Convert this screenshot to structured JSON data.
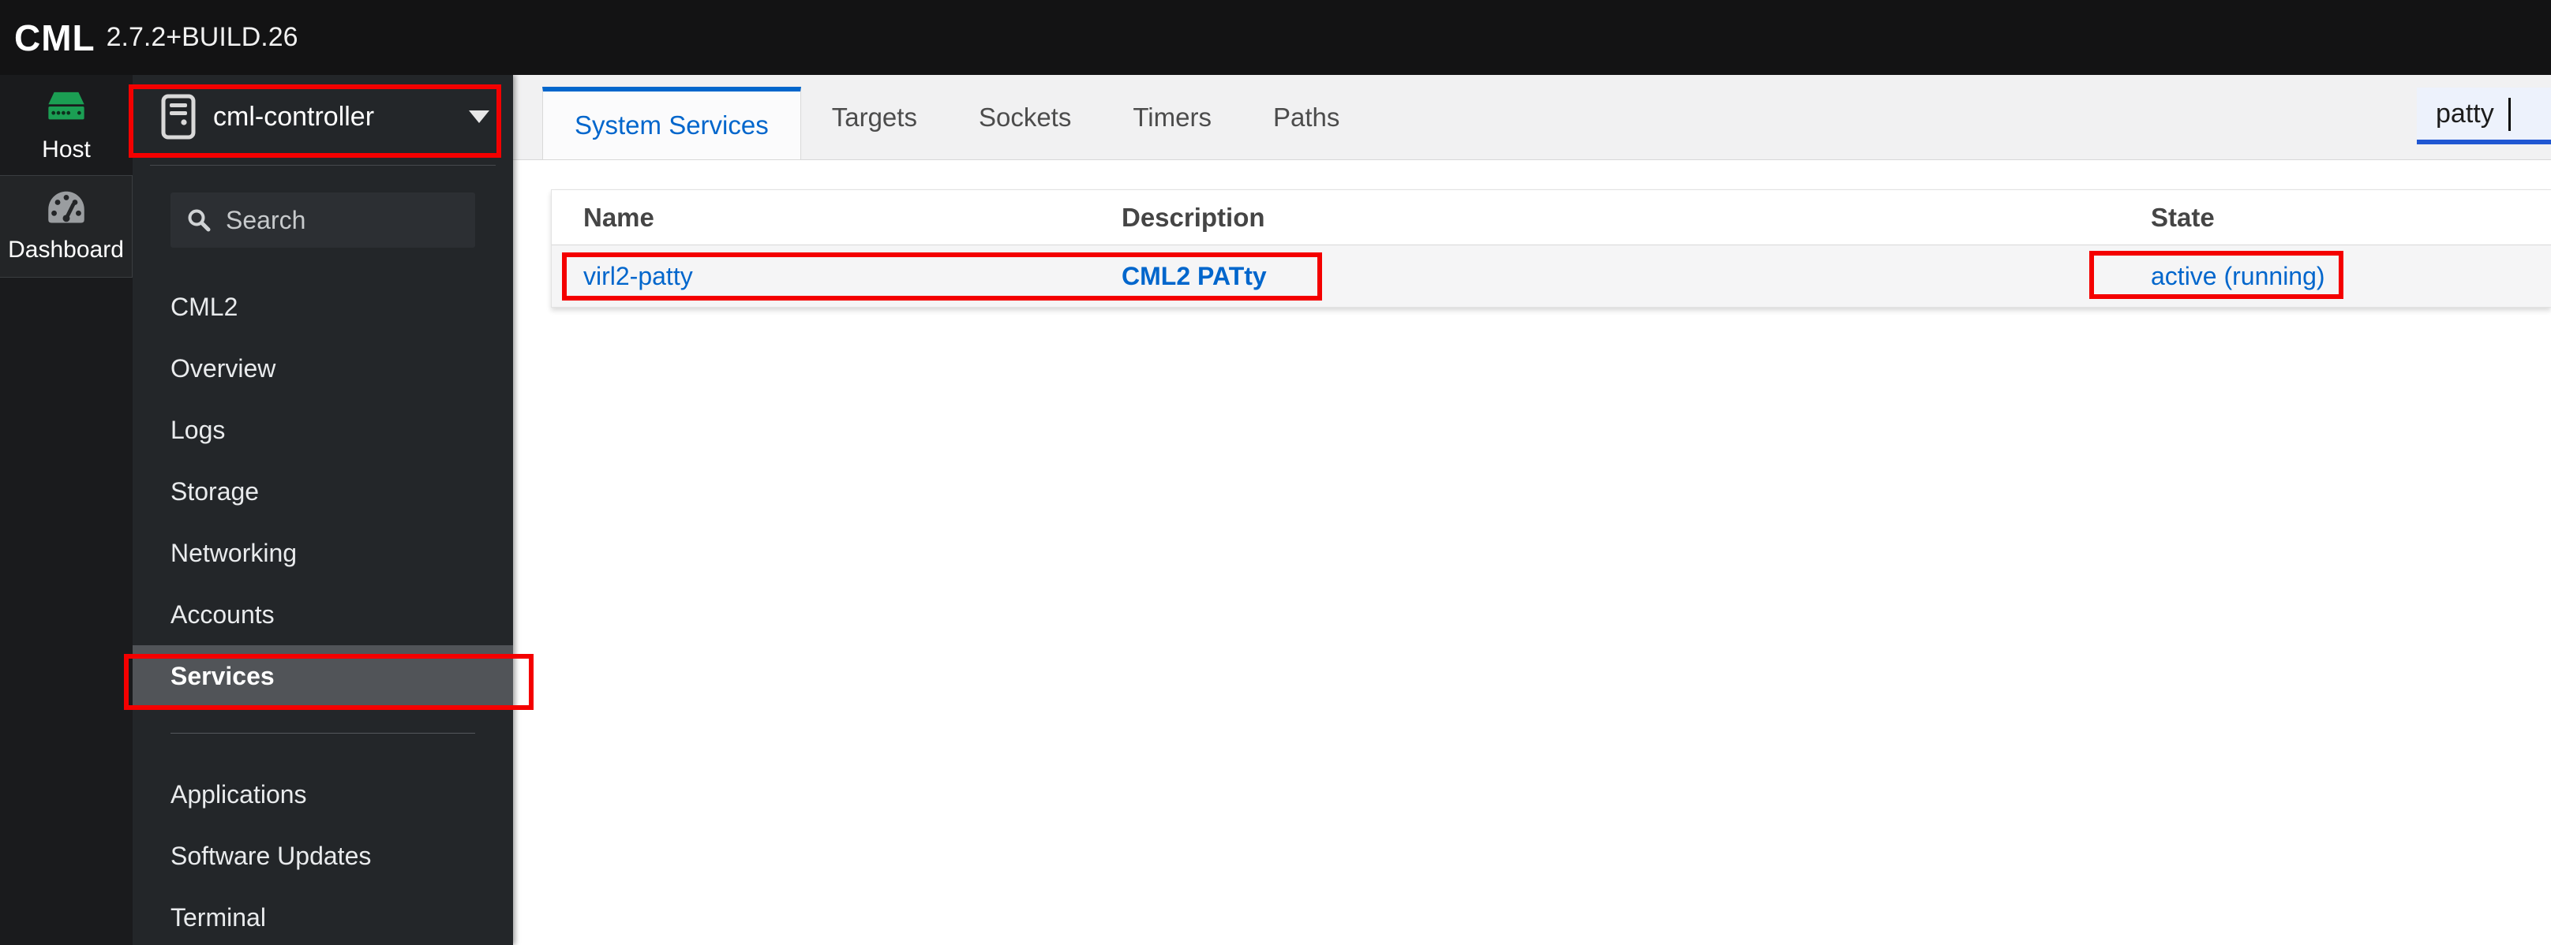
{
  "header": {
    "brand": "CML",
    "version": "2.7.2+BUILD.26"
  },
  "app_nav": {
    "items": [
      {
        "label": "Host",
        "icon": "server-icon"
      },
      {
        "label": "Dashboard",
        "icon": "gauge-icon"
      }
    ]
  },
  "sidebar": {
    "host_selector": {
      "label": "cml-controller",
      "icon": "server-outline-icon"
    },
    "search": {
      "placeholder": "Search",
      "icon": "search-icon"
    },
    "menu": {
      "primary": [
        "CML2",
        "Overview",
        "Logs",
        "Storage",
        "Networking",
        "Accounts",
        "Services"
      ],
      "secondary": [
        "Applications",
        "Software Updates",
        "Terminal"
      ],
      "selected": "Services"
    }
  },
  "main": {
    "tabs": {
      "items": [
        "System Services",
        "Targets",
        "Sockets",
        "Timers",
        "Paths"
      ],
      "active": "System Services"
    },
    "filter": {
      "value": "patty"
    },
    "table": {
      "columns": [
        "Name",
        "Description",
        "State"
      ],
      "rows": [
        {
          "name": "virl2-patty",
          "description": "CML2 PATty",
          "state": "active (running)"
        }
      ]
    }
  },
  "colors": {
    "accent_blue": "#0066cc",
    "annotation_red": "#f40000",
    "host_icon_green": "#1b9e53",
    "sidebar_selected_gray": "#515458"
  },
  "annotations": [
    "host-selector-box",
    "services-menu-box",
    "service-row-box",
    "service-state-box"
  ]
}
